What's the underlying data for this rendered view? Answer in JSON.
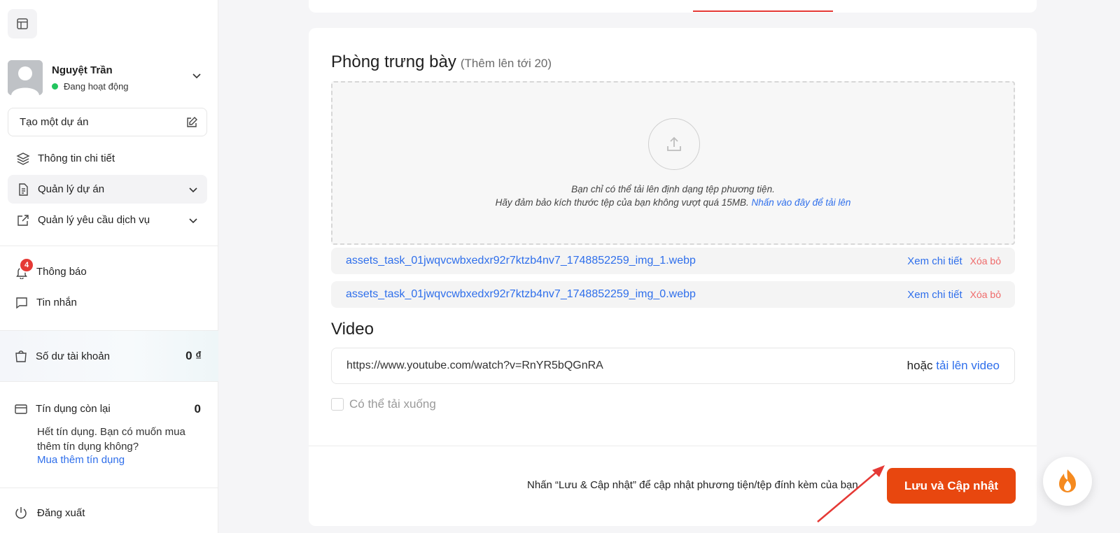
{
  "sidebar": {
    "user": {
      "name": "Nguyệt Trần",
      "status": "Đang hoạt động"
    },
    "create_project": "Tạo một dự án",
    "items": [
      {
        "label": "Thông tin chi tiết",
        "icon": "layers-icon"
      },
      {
        "label": "Quản lý dự án",
        "icon": "document-icon",
        "active": true
      },
      {
        "label": "Quản lý yêu cầu dịch vụ",
        "icon": "external-link-icon"
      }
    ],
    "notifications": {
      "label": "Thông báo",
      "count": "4"
    },
    "messages": {
      "label": "Tin nhắn"
    },
    "balance": {
      "label": "Số dư tài khoản",
      "value": "0 ₫"
    },
    "credits": {
      "label": "Tín dụng còn lại",
      "value": "0",
      "message": "Hết tín dụng. Bạn có muốn mua thêm tín dụng không?",
      "buy_link": "Mua thêm tín dụng"
    },
    "logout": "Đăng xuất"
  },
  "gallery": {
    "title": "Phòng trưng bày",
    "subtitle": "(Thêm lên tới 20)",
    "dropzone_line1": "Bạn chỉ có thể tải lên định dạng tệp phương tiện.",
    "dropzone_line2": "Hãy đảm bảo kích thước tệp của bạn không vượt quá 15MB.",
    "dropzone_link": "Nhấn vào đây để tải lên",
    "files": [
      {
        "name": "assets_task_01jwqvcwbxedxr92r7ktzb4nv7_1748852259_img_1.webp",
        "view": "Xem chi tiết",
        "delete": "Xóa bỏ"
      },
      {
        "name": "assets_task_01jwqvcwbxedxr92r7ktzb4nv7_1748852259_img_0.webp",
        "view": "Xem chi tiết",
        "delete": "Xóa bỏ"
      }
    ]
  },
  "video": {
    "title": "Video",
    "url": "https://www.youtube.com/watch?v=RnYR5bQGnRA",
    "or_text": "hoặc",
    "upload_link": "tải lên video",
    "downloadable_label": "Có thể tải xuống"
  },
  "footer": {
    "hint": "Nhấn “Lưu & Cập nhật” để cập nhật phương tiện/tệp đính kèm của bạn",
    "save_button": "Lưu và Cập nhật"
  },
  "colors": {
    "accent": "#e8470f",
    "link": "#2f6feb",
    "danger": "#e53935",
    "online": "#22c55e"
  }
}
